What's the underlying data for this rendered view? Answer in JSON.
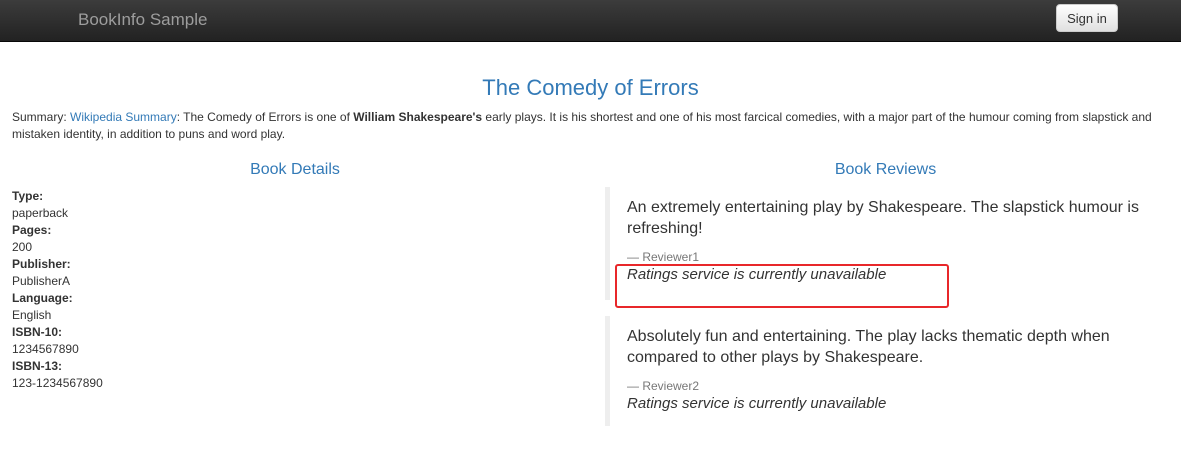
{
  "navbar": {
    "brand": "BookInfo Sample",
    "signin_label": "Sign in"
  },
  "book": {
    "title": "The Comedy of Errors",
    "summary_prefix": "Summary: ",
    "summary_link": "Wikipedia Summary",
    "summary_text_1": ": The Comedy of Errors is one of ",
    "summary_bold": "William Shakespeare's",
    "summary_text_2": " early plays. It is his shortest and one of his most farcical comedies, with a major part of the humour coming from slapstick and mistaken identity, in addition to puns and word play."
  },
  "details": {
    "heading": "Book Details",
    "type_label": "Type:",
    "type_value": "paperback",
    "pages_label": "Pages:",
    "pages_value": "200",
    "publisher_label": "Publisher:",
    "publisher_value": "PublisherA",
    "language_label": "Language:",
    "language_value": "English",
    "isbn10_label": "ISBN-10:",
    "isbn10_value": "1234567890",
    "isbn13_label": "ISBN-13:",
    "isbn13_value": "123-1234567890"
  },
  "reviews": {
    "heading": "Book Reviews",
    "items": [
      {
        "text": "An extremely entertaining play by Shakespeare. The slapstick humour is refreshing!",
        "reviewer": "— Reviewer1",
        "rating": "Ratings service is currently unavailable"
      },
      {
        "text": "Absolutely fun and entertaining. The play lacks thematic depth when compared to other plays by Shakespeare.",
        "reviewer": "— Reviewer2",
        "rating": "Ratings service is currently unavailable"
      }
    ]
  },
  "colors": {
    "accent": "#337ab7",
    "highlight": "#e8272a",
    "navbar": "#222222"
  }
}
